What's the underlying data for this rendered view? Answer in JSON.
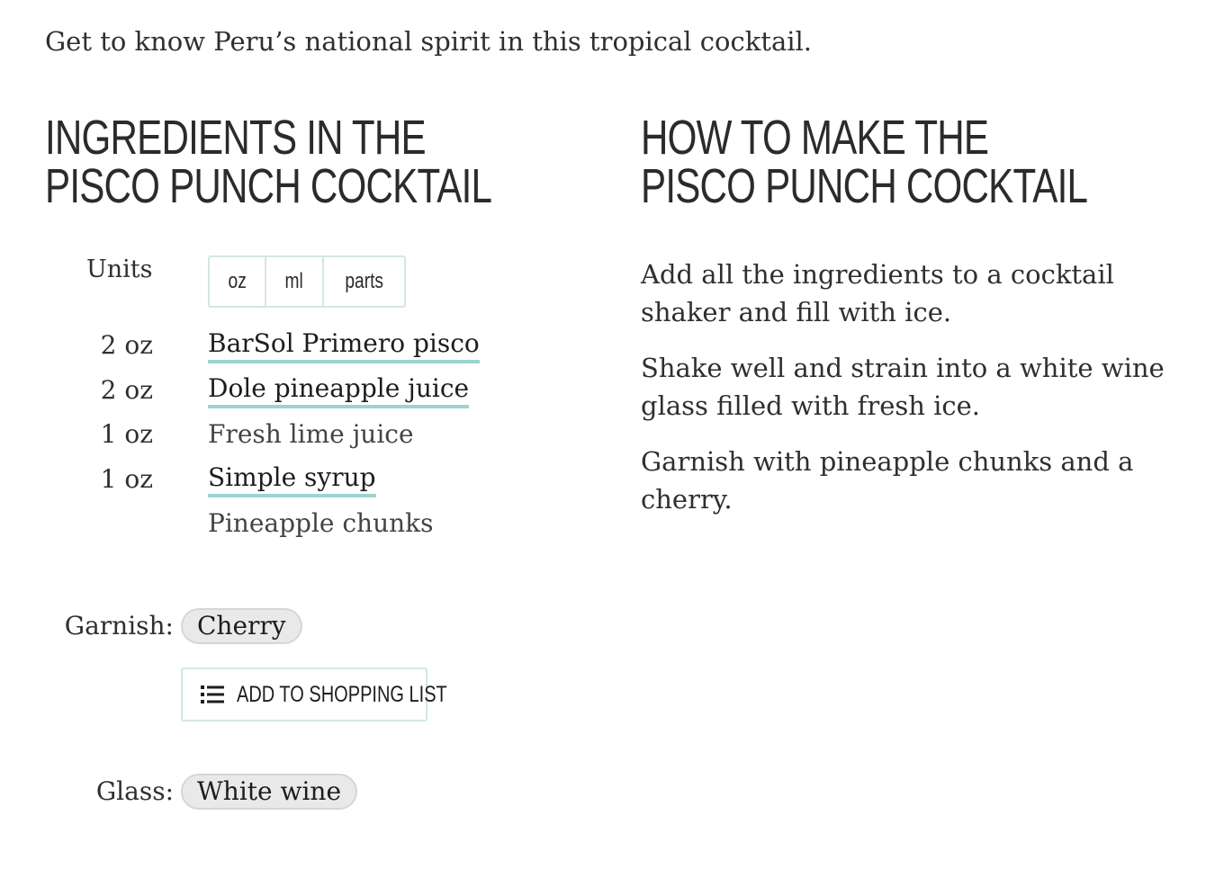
{
  "intro": "Get to know Peru’s national spirit in this tropical cocktail.",
  "ingredients_section": {
    "heading": "INGREDIENTS IN THE PISCO PUNCH COCKTAIL",
    "units_label": "Units",
    "unit_options": [
      "oz",
      "ml",
      "parts"
    ],
    "items": [
      {
        "amount": "2 oz",
        "name": "BarSol Primero pisco",
        "link": true
      },
      {
        "amount": "2 oz",
        "name": "Dole pineapple juice",
        "link": true
      },
      {
        "amount": "1 oz",
        "name": "Fresh lime juice",
        "link": false
      },
      {
        "amount": "1 oz",
        "name": "Simple syrup",
        "link": true
      },
      {
        "amount": "",
        "name": "Pineapple chunks",
        "link": false
      }
    ],
    "garnish_label": "Garnish:",
    "garnish_value": "Cherry",
    "shopping_button": "ADD TO SHOPPING LIST",
    "glass_label": "Glass:",
    "glass_value": "White wine"
  },
  "method_section": {
    "heading": "HOW TO MAKE THE PISCO PUNCH COCKTAIL",
    "steps": [
      "Add all the ingredients to a cocktail shaker and fill with ice.",
      "Shake well and strain into a white wine glass filled with fresh ice.",
      "Garnish with pineapple chunks and a cherry."
    ]
  },
  "colors": {
    "link_underline": "#9ed2cf",
    "border": "#d4e6e6",
    "pill_bg": "#e9e9e9",
    "text": "#2b2b2b"
  },
  "icons": {
    "shopping_list": "list-icon"
  }
}
